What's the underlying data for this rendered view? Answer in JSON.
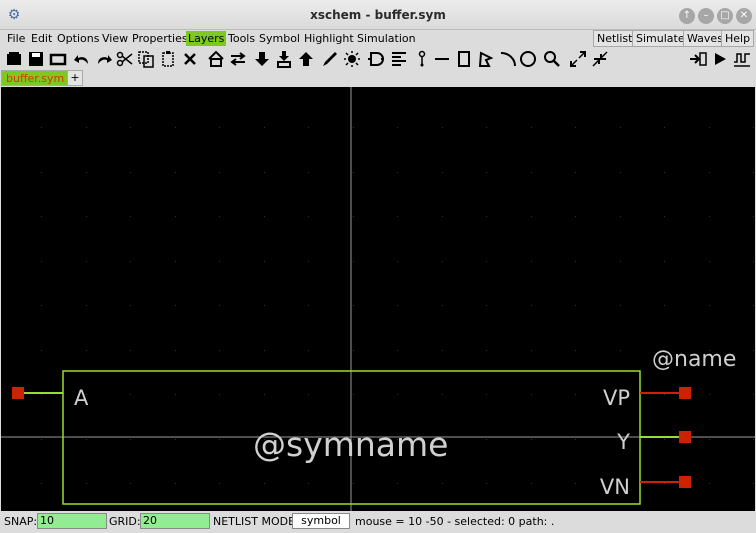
{
  "window": {
    "title": "xschem - buffer.sym",
    "app_icon": "xschem-icon",
    "buttons": [
      "minimize-to-top-icon",
      "minimize-icon",
      "maximize-icon",
      "close-icon"
    ]
  },
  "menubar": {
    "items": [
      "File",
      "Edit",
      "Options",
      "View",
      "Properties",
      "Layers",
      "Tools",
      "Symbol",
      "Highlight",
      "Simulation"
    ],
    "active": "Layers",
    "right_buttons": [
      "Netlist",
      "Simulate",
      "Waves",
      "Help"
    ]
  },
  "toolbar": {
    "icons": [
      "new-schematic-icon",
      "save-icon",
      "reload-icon",
      "undo-icon",
      "redo-icon",
      "cut-icon",
      "copy-icon",
      "paste-icon",
      "delete-icon",
      "push-icon",
      "swap-icon",
      "descend-icon",
      "merge-icon",
      "ascend-icon",
      "pen-icon",
      "highlight-icon",
      "netlist-symbol-icon",
      "align-icon",
      "pin-icon",
      "line-icon",
      "rect-icon",
      "polygon-icon",
      "arc-icon",
      "circle-icon",
      "zoom-icon",
      "zoom-in-icon",
      "zoom-out-icon",
      "insert-icon",
      "simulate-icon",
      "waves-icon"
    ]
  },
  "tabs": {
    "items": [
      "buffer.sym"
    ],
    "add_label": "+"
  },
  "canvas": {
    "background": "#000000",
    "grid_color": "#333333",
    "axis_color": "#9a9a9a",
    "box_color": "#99dd33",
    "pin_color": "#cc2200",
    "wire_out_color": "#cc2200",
    "text_color": "#d0d0d0",
    "labels": {
      "name": "@name",
      "symname": "@symname",
      "pin_a": "A",
      "pin_vp": "VP",
      "pin_y": "Y",
      "pin_vn": "VN"
    }
  },
  "statusbar": {
    "snap_label": "SNAP:",
    "snap_value": "10",
    "grid_label": "GRID:",
    "grid_value": "20",
    "netlist_label": "NETLIST MODE:",
    "netlist_value": "symbol",
    "info": "mouse = 10 -50 - selected: 0 path: ."
  }
}
